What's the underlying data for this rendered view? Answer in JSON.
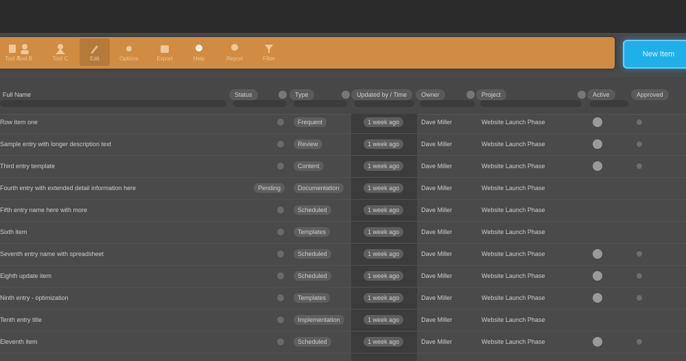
{
  "toolbar": {
    "tools": [
      {
        "label": "Tool A",
        "icon": "document-icon"
      },
      {
        "label": "Tool B",
        "icon": "user-icon"
      },
      {
        "label": "Tool C",
        "icon": "group-icon"
      },
      {
        "label": "Edit",
        "icon": "pencil-icon"
      },
      {
        "label": "Options",
        "icon": "settings-icon"
      },
      {
        "label": "Export",
        "icon": "box-icon"
      },
      {
        "label": "Help",
        "icon": "bulb-icon"
      },
      {
        "label": "Report",
        "icon": "person-icon"
      },
      {
        "label": "Filter",
        "icon": "funnel-icon"
      }
    ],
    "primary_button": "New Item"
  },
  "table": {
    "headers": {
      "name": "Full Name",
      "status": "Status",
      "type": "Type",
      "updated": "Updated by / Time",
      "owner": "Owner",
      "project": "Project",
      "flag_a": "Active",
      "flag_b": "Approved"
    },
    "rows": [
      {
        "name": "Row item one",
        "type": "Frequent",
        "updated": "1 week ago",
        "owner": "Dave Miller",
        "project": "Website Launch Phase"
      },
      {
        "name": "Sample entry with longer description text",
        "type": "Review",
        "updated": "1 week ago",
        "owner": "Dave Miller",
        "project": "Website Launch Phase"
      },
      {
        "name": "Third entry template",
        "type": "Content",
        "updated": "1 week ago",
        "owner": "Dave Miller",
        "project": "Website Launch Phase"
      },
      {
        "name": "Fourth entry with extended detail information here",
        "status": "Pending",
        "type": "Documentation",
        "updated": "1 week ago",
        "owner": "Dave Miller",
        "project": "Website Launch Phase"
      },
      {
        "name": "Fifth entry name here with more",
        "type": "Scheduled",
        "updated": "1 week ago",
        "owner": "Dave Miller",
        "project": "Website Launch Phase"
      },
      {
        "name": "Sixth item",
        "type": "Templates",
        "updated": "1 week ago",
        "owner": "Dave Miller",
        "project": "Website Launch Phase"
      },
      {
        "name": "Seventh entry name with spreadsheet",
        "type": "Scheduled",
        "updated": "1 week ago",
        "owner": "Dave Miller",
        "project": "Website Launch Phase"
      },
      {
        "name": "Eighth update item",
        "type": "Scheduled",
        "updated": "1 week ago",
        "owner": "Dave Miller",
        "project": "Website Launch Phase"
      },
      {
        "name": "Ninth entry - optimization",
        "type": "Templates",
        "updated": "1 week ago",
        "owner": "Dave Miller",
        "project": "Website Launch Phase"
      },
      {
        "name": "Tenth entry title",
        "type": "Implementation",
        "updated": "1 week ago",
        "owner": "Dave Miller",
        "project": "Website Launch Phase"
      },
      {
        "name": "Eleventh item",
        "type": "Scheduled",
        "updated": "1 week ago",
        "owner": "Dave Miller",
        "project": "Website Launch Phase"
      }
    ]
  }
}
